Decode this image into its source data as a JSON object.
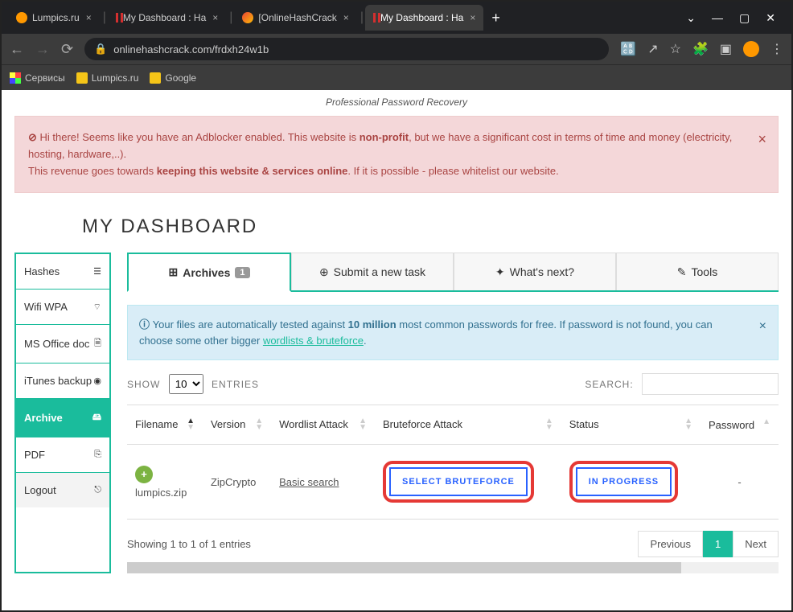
{
  "window": {
    "minimize": "—",
    "maximize": "▢",
    "close": "✕",
    "chevron": "⌄"
  },
  "tabs": [
    {
      "title": "Lumpics.ru",
      "icon_color": "#ff9800"
    },
    {
      "title": "My Dashboard : Ha",
      "icon_color": "#d32f2f"
    },
    {
      "title": "[OnlineHashCrack",
      "icon_color": "#ea4335"
    },
    {
      "title": "My Dashboard : Ha",
      "icon_color": "#d32f2f",
      "active": true
    }
  ],
  "url": "onlinehashcrack.com/frdxh24w1b",
  "bookmarks": {
    "services": "Сервисы",
    "b1": "Lumpics.ru",
    "b2": "Google"
  },
  "tagline": "Professional Password Recovery",
  "adblock": {
    "pre": "Hi there! Seems like you have an Adblocker enabled. This website is ",
    "nonprofit": "non-profit",
    "post1": ", but we have a significant cost in terms of time and money (electricity, hosting, hardware,..).",
    "line2a": "This revenue goes towards ",
    "line2b": "keeping this website & services online",
    "line2c": ". If it is possible - please whitelist our website."
  },
  "page_title": "MY DASHBOARD",
  "sidebar": {
    "hashes": "Hashes",
    "wifi": "Wifi WPA",
    "office": "MS Office doc",
    "itunes": "iTunes backup",
    "archive": "Archive",
    "pdf": "PDF",
    "logout": "Logout"
  },
  "tabs_nav": {
    "archives": "Archives",
    "archives_badge": "1",
    "submit": "Submit a new task",
    "whats_next": "What's next?",
    "tools": "Tools"
  },
  "info": {
    "t1": "Your files are automatically tested against ",
    "t2": "10 million",
    "t3": " most common passwords for free. If password is not found, you can choose some other bigger ",
    "link": "wordlists & bruteforce",
    "t4": "."
  },
  "table": {
    "show": "SHOW",
    "entries": "ENTRIES",
    "show_value": "10",
    "search": "SEARCH:",
    "headers": {
      "filename": "Filename",
      "version": "Version",
      "wordlist": "Wordlist Attack",
      "bruteforce": "Bruteforce Attack",
      "status": "Status",
      "password": "Password"
    },
    "row": {
      "filename": "lumpics.zip",
      "version": "ZipCrypto",
      "wordlist": "Basic search",
      "bruteforce_btn": "SELECT BRUTEFORCE",
      "status_btn": "IN PROGRESS",
      "password": "-"
    },
    "showing": "Showing 1 to 1 of 1 entries",
    "prev": "Previous",
    "page": "1",
    "next": "Next"
  }
}
